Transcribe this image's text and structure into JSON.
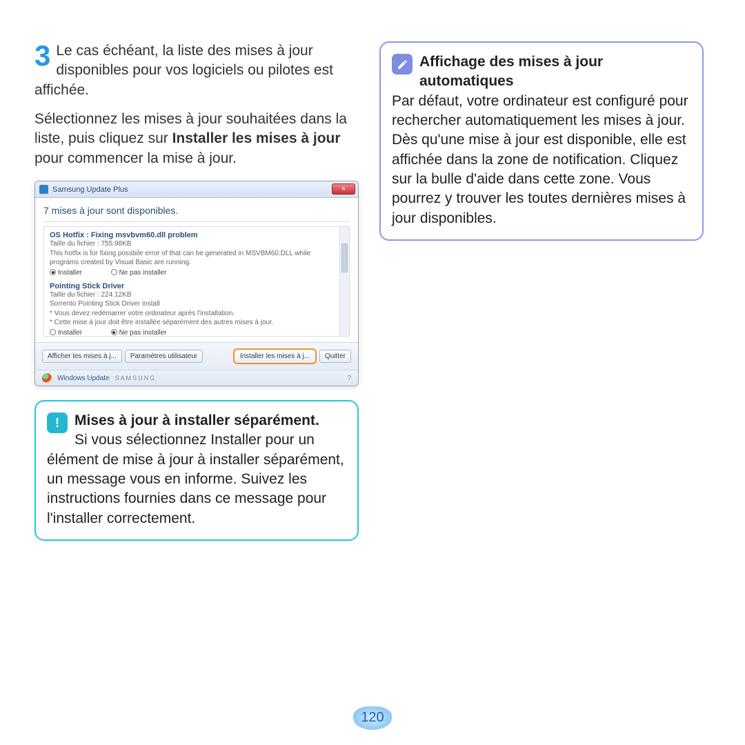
{
  "page_number": "120",
  "step": {
    "number": "3",
    "para1": "Le cas échéant, la liste des mises à jour disponibles pour vos logiciels ou pilotes est affichée.",
    "para2a": "Sélectionnez les mises à jour souhaitées dans la liste, puis cliquez sur ",
    "para2_bold": "Installer les mises à jour",
    "para2b": " pour commencer la mise à jour."
  },
  "dialog": {
    "window_title": "Samsung Update Plus",
    "close_glyph": "×",
    "heading": "7 mises à jour sont disponibles.",
    "update1": {
      "title": "OS Hotfix : Fixing msvbvm60.dll problem",
      "size": "Taille du fichier : 755.98KB",
      "desc": "This hotfix is for fixing possbile error of that can be generated in MSVBM60.DLL while programs created by Visual Basic are running.",
      "opt_install": "Installer",
      "opt_skip": "Ne pas installer"
    },
    "update2": {
      "title": "Pointing Stick Driver",
      "size": "Taille du fichier : 224.12KB",
      "desc": "Sorrento Pointing Stick Driver install",
      "note1": "* Vous devez redémarrer votre ordinateur après l'installation.",
      "note2": "* Cette mise à jour doit être installée séparément des autres mises à jour.",
      "opt_install": "Installer",
      "opt_skip": "Ne pas installer"
    },
    "buttons": {
      "show": "Afficher les mises à j...",
      "params": "Paramètres utilisateur",
      "install": "Installer les mises à j...",
      "quit": "Quitter"
    },
    "status": {
      "windows_update": "Windows Update",
      "brand": "SAMSUNG",
      "help": "?"
    }
  },
  "callout_cyan": {
    "title": "Mises à jour à installer séparément.",
    "body": "Si vous sélectionnez Installer pour un élément de mise à jour à installer séparément, un message vous en informe. Suivez les instructions fournies dans ce message pour l'installer correctement."
  },
  "callout_purple": {
    "title": "Affichage des mises à jour automatiques",
    "body": "Par défaut, votre ordinateur est configuré pour rechercher automatiquement les mises à jour. Dès qu'une mise à jour est disponible, elle est affichée dans la zone de notification. Cliquez sur la bulle d'aide dans cette zone. Vous pourrez y trouver les toutes dernières mises à jour disponibles."
  }
}
